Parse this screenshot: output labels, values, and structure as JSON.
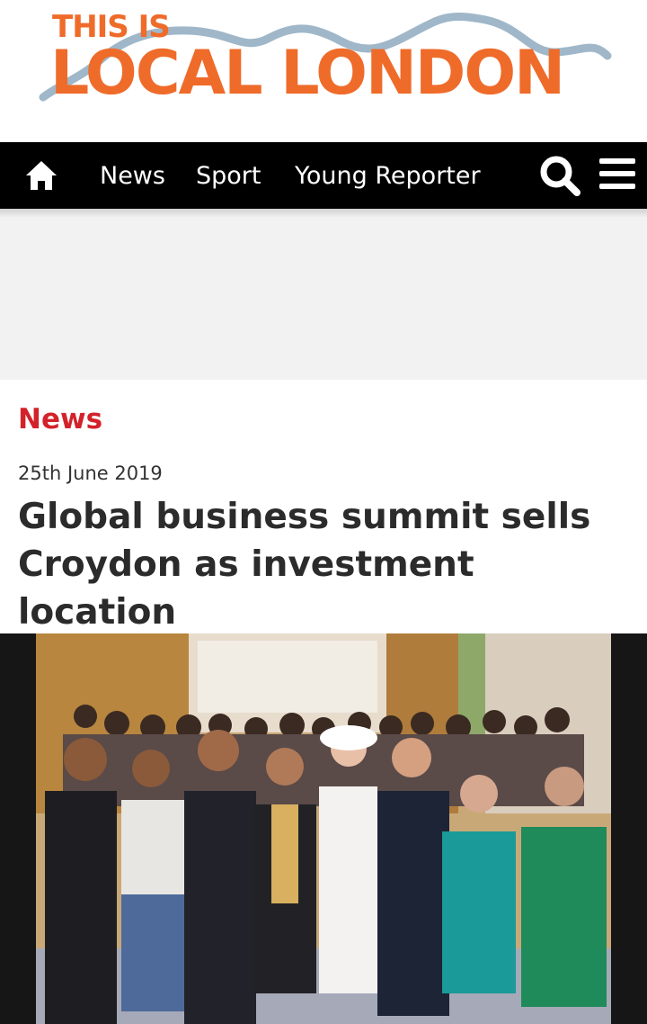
{
  "masthead": {
    "logo_line1": "THIS IS",
    "logo_line2": "LOCAL LONDON",
    "brand_color": "#ef6b2a",
    "river_color": "#9fb7c9"
  },
  "nav": {
    "home_icon": "home-icon",
    "items": [
      {
        "label": "News"
      },
      {
        "label": "Sport"
      },
      {
        "label": "Young Reporter"
      }
    ],
    "search_icon": "search-icon",
    "menu_icon": "hamburger-menu-icon",
    "background": "#000000"
  },
  "article": {
    "section": "News",
    "section_color": "#d3222a",
    "date": "25th June 2019",
    "title": "Global business summit sells Croydon as investment location"
  }
}
